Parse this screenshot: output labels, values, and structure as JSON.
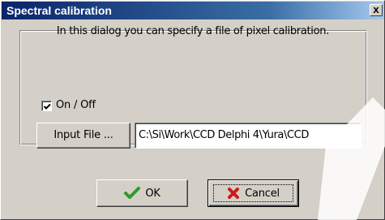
{
  "window": {
    "title": "Spectral calibration",
    "close_label": "x"
  },
  "description": "In this dialog you can specify a file of pixel calibration.",
  "on_off": {
    "label": "On / Off",
    "checked": true
  },
  "input_file": {
    "button_label": "Input File ...",
    "path_value": "C:\\Si\\Work\\CCD Delphi 4\\Yura\\CCD"
  },
  "buttons": {
    "ok_label": "OK",
    "cancel_label": "Cancel"
  },
  "icons": {
    "ok": "checkmark-icon",
    "cancel": "red-x-icon",
    "checkbox": "check-icon"
  },
  "colors": {
    "titlebar_start": "#0a246a",
    "titlebar_end": "#a6caf0",
    "face": "#d4d0c8",
    "ok_check": "#2e9a2e",
    "cancel_x": "#cc1a1a"
  }
}
